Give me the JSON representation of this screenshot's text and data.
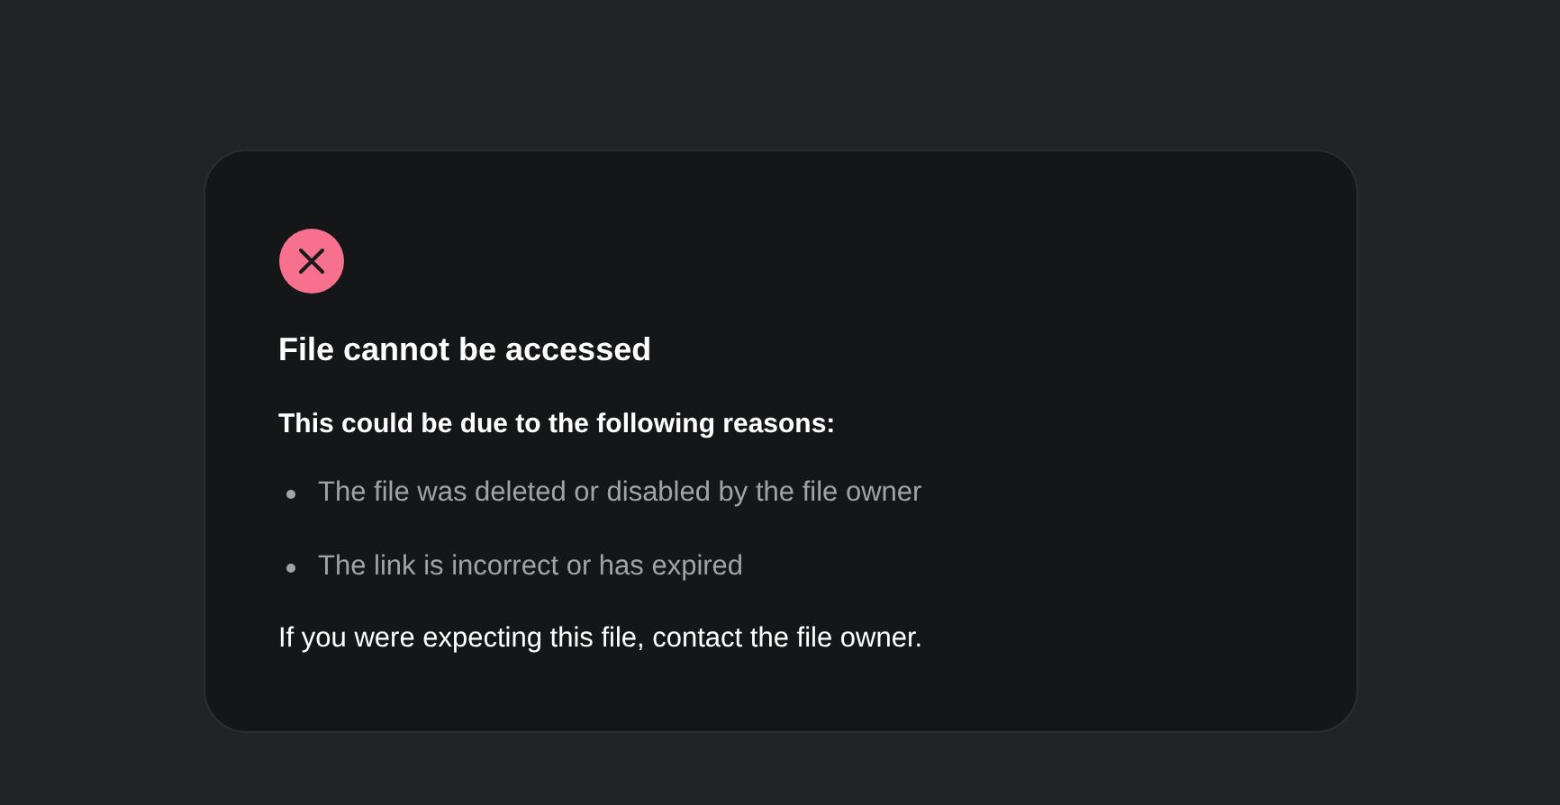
{
  "dialog": {
    "title": "File cannot be accessed",
    "subtitle": "This could be due to the following reasons:",
    "reasons": [
      "The file was deleted or disabled by the file owner",
      "The link is incorrect or has expired"
    ],
    "footer": "If you were expecting this file, contact the file owner."
  }
}
